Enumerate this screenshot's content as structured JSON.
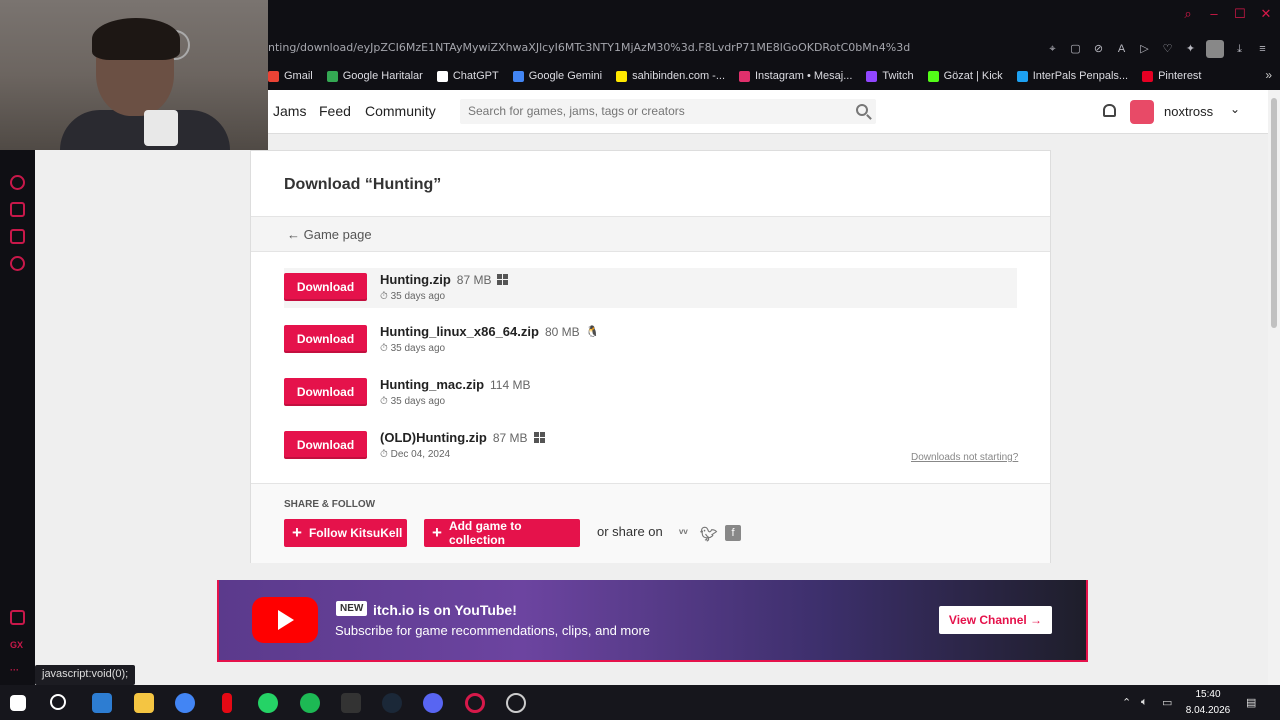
{
  "browser": {
    "url": "nting/download/eyJpZCI6MzE1NTAyMywiZXhwaXJlcyI6MTc3NTY1MjAzM30%3d.F8LvdrP71ME8lGoOKDRotC0bMn4%3d",
    "bookmarks": [
      {
        "label": "Gmail",
        "color": "#ea4335"
      },
      {
        "label": "Google Haritalar",
        "color": "#34a853"
      },
      {
        "label": "ChatGPT",
        "color": "#ffffff"
      },
      {
        "label": "Google Gemini",
        "color": "#4285f4"
      },
      {
        "label": "sahibinden.com -...",
        "color": "#ffe800"
      },
      {
        "label": "Instagram • Mesaj...",
        "color": "#e1306c"
      },
      {
        "label": "Twitch",
        "color": "#9146ff"
      },
      {
        "label": "Gözat | Kick",
        "color": "#53fc18"
      },
      {
        "label": "InterPals Penpals...",
        "color": "#1da1f2"
      },
      {
        "label": "Pinterest",
        "color": "#e60023"
      }
    ],
    "status_url": "javascript:void(0);"
  },
  "header": {
    "nav": {
      "jams": "Jams",
      "feed": "Feed",
      "community": "Community"
    },
    "search_placeholder": "Search for games, jams, tags or creators",
    "username": "noxtross"
  },
  "download_page": {
    "title": "Download “Hunting”",
    "back_link": "← Game page",
    "button_label": "Download",
    "uploads": [
      {
        "name": "Hunting.zip",
        "size": "87 MB",
        "os": "windows",
        "date": "35 days ago"
      },
      {
        "name": "Hunting_linux_x86_64.zip",
        "size": "80 MB",
        "os": "linux",
        "date": "35 days ago"
      },
      {
        "name": "Hunting_mac.zip",
        "size": "114 MB",
        "os": "mac",
        "date": "35 days ago"
      },
      {
        "name": "(OLD)Hunting.zip",
        "size": "87 MB",
        "os": "windows",
        "date": "Dec 04, 2024"
      }
    ],
    "not_starting": "Downloads not starting?",
    "share_heading": "SHARE & FOLLOW",
    "follow_button": "Follow KitsuKell",
    "collection_button": "Add game to collection",
    "share_on": "or share on"
  },
  "banner": {
    "badge": "NEW",
    "title": "itch.io is on YouTube!",
    "subtitle": "Subscribe for game recommendations, clips, and more",
    "button": "View Channel →"
  },
  "taskbar": {
    "time": "15:40",
    "date": "8.04.2026"
  },
  "colors": {
    "accent": "#e5124b",
    "opera_red": "#c8184a"
  }
}
